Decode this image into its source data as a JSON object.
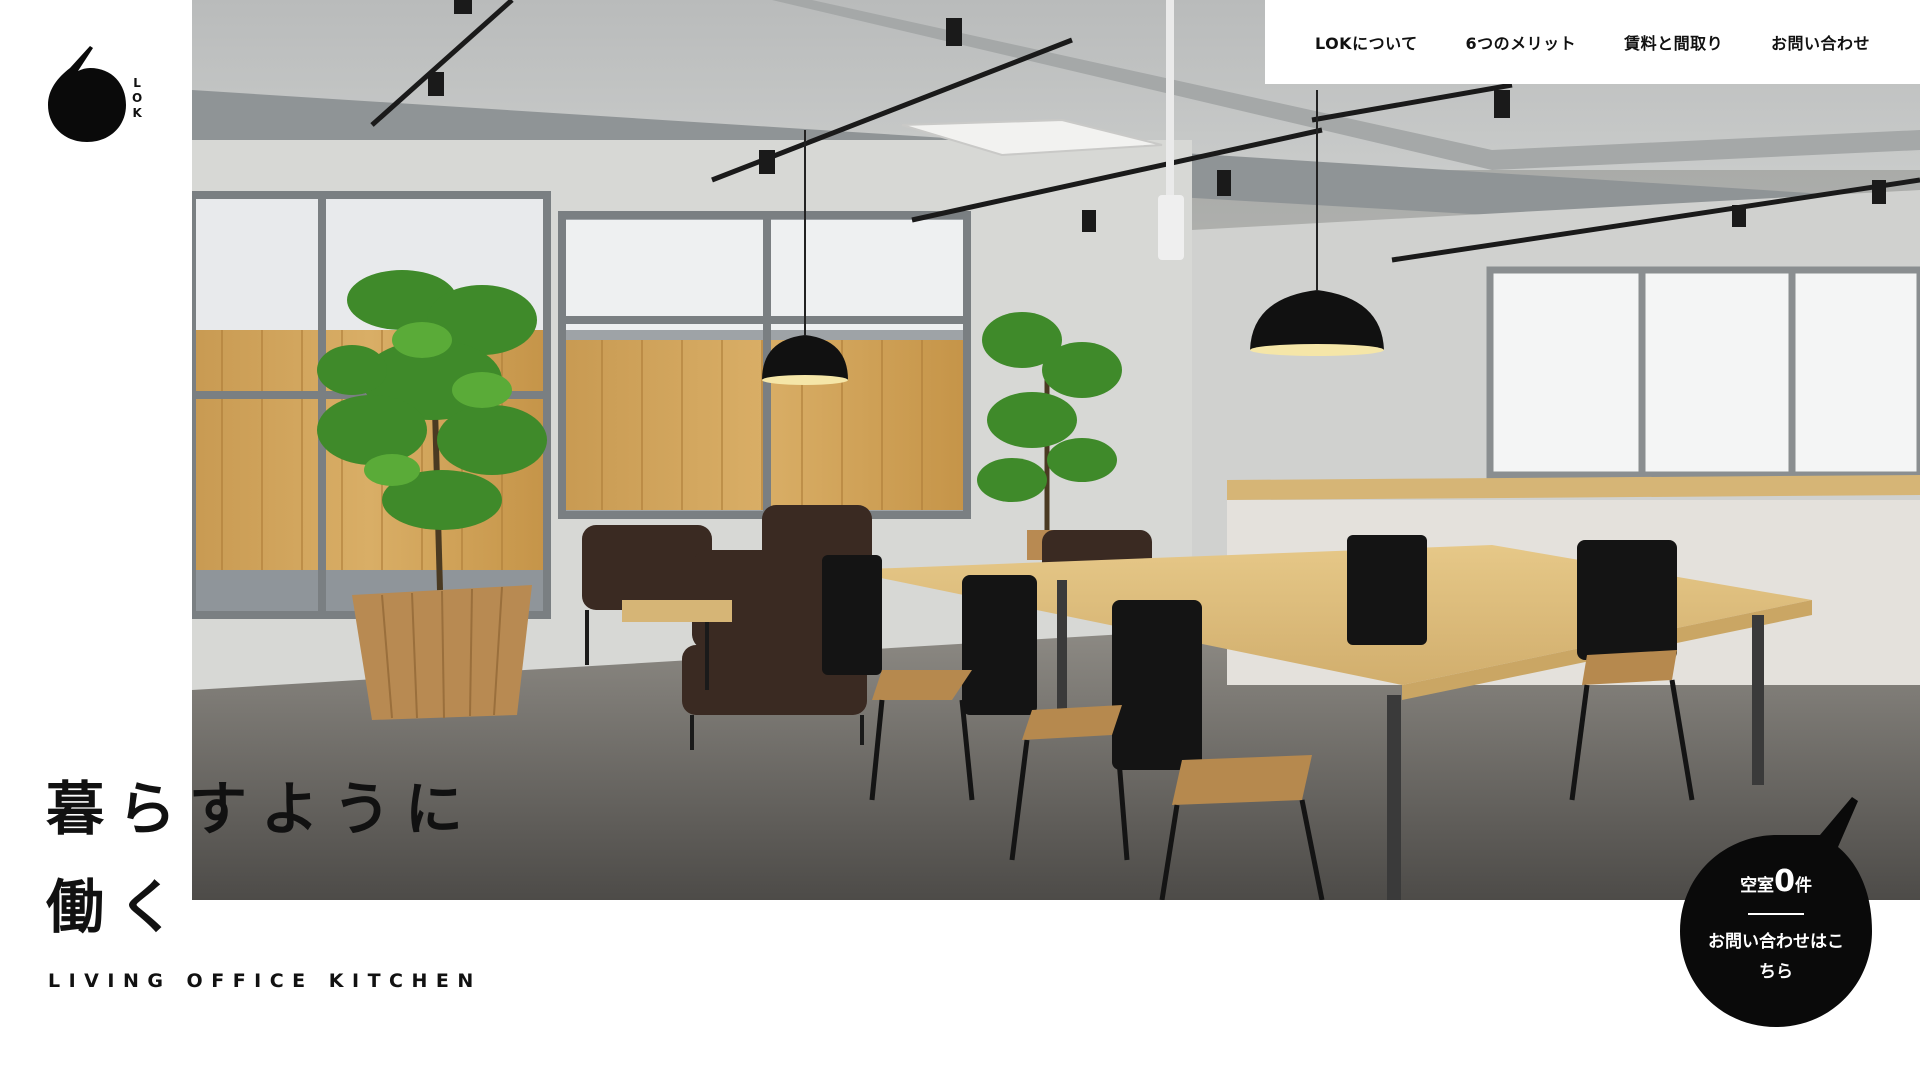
{
  "logo": {
    "letters": [
      "L",
      "O",
      "K"
    ]
  },
  "nav": {
    "items": [
      {
        "label": "LOKについて"
      },
      {
        "label": "6つのメリット"
      },
      {
        "label": "賃料と間取り"
      },
      {
        "label": "お問い合わせ"
      }
    ]
  },
  "hero": {
    "headline_line1": "暮らすように",
    "headline_line2": "働く",
    "subtitle": "LIVING OFFICE KITCHEN"
  },
  "badge": {
    "prefix": "空室",
    "count": "0",
    "suffix": "件",
    "cta": "お問い合わせはこちら"
  },
  "colors": {
    "text": "#111111",
    "background": "#ffffff",
    "badge": "#0a0a0a"
  }
}
